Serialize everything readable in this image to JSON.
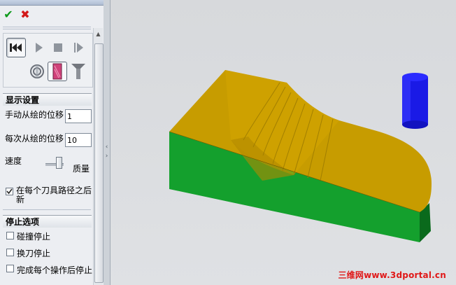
{
  "panel": {
    "ok_symbol": "✔",
    "cancel_symbol": "✖"
  },
  "toolbar": {
    "icons": [
      "rewind-to-start-icon",
      "play-icon",
      "stop-icon",
      "step-forward-icon",
      "tool-holder-icon",
      "stock-icon",
      "tool-icon"
    ]
  },
  "display_settings": {
    "title": "显示设置",
    "manual_step_label": "手动从绘的位移",
    "manual_step_value": "1",
    "each_step_label": "每次从绘的位移",
    "each_step_value": "10",
    "speed_label": "速度",
    "quality_label": "质量",
    "update_label_line1": "在每个刀具路径之后",
    "update_label_line2": "新",
    "update_checked": true
  },
  "stop_options": {
    "title": "停止选项",
    "collision_label": "碰撞停止",
    "collision_checked": false,
    "tool_change_label": "换刀停止",
    "tool_change_checked": false,
    "each_op_label": "完成每个操作后停止",
    "each_op_checked": false
  },
  "viewport": {
    "watermark": "三维网www.3dportal.cn",
    "colors": {
      "top_face": "#c79c00",
      "side_face": "#14a02d",
      "side_dark": "#0a6a1c",
      "tool": "#1a1ae6",
      "watermark": "#e01818"
    }
  }
}
